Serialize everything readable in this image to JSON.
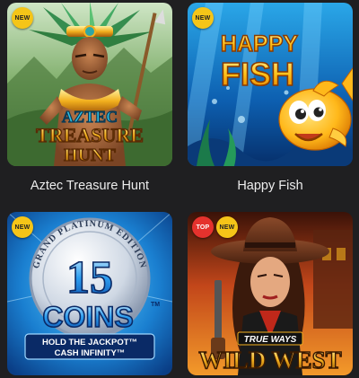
{
  "games": [
    {
      "title": "Aztec Treasure Hunt",
      "badges": [
        "NEW"
      ],
      "art_text": {
        "line1": "AZTEC",
        "line2": "TREASURE",
        "line3": "HUNT"
      }
    },
    {
      "title": "Happy Fish",
      "badges": [
        "NEW"
      ],
      "art_text": {
        "line1": "HAPPY",
        "line2": "FISH"
      }
    },
    {
      "title": "",
      "badges": [
        "NEW"
      ],
      "art_text": {
        "arc": "GRAND PLATINUM EDITION",
        "number": "15",
        "word": "COINS",
        "tm": "TM",
        "sub1": "HOLD THE JACKPOT™",
        "sub2": "CASH INFINITY™"
      }
    },
    {
      "title": "",
      "badges": [
        "TOP",
        "NEW"
      ],
      "art_text": {
        "tag": "TRUE WAYS",
        "main": "WILD WEST"
      }
    }
  ],
  "colors": {
    "background": "#1f1f21",
    "title_text": "#ececec",
    "badge_new": "#f5c518",
    "badge_top": "#e5322d"
  }
}
